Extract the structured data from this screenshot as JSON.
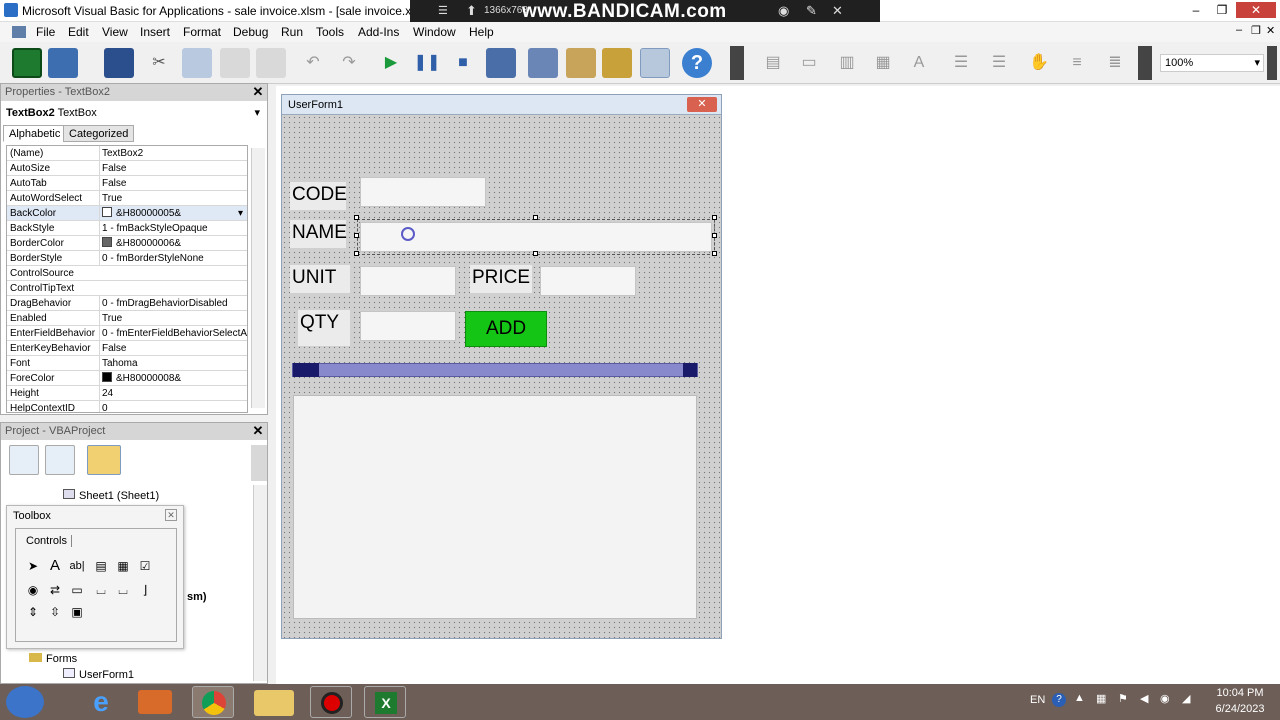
{
  "window": {
    "title": "Microsoft Visual Basic for Applications - sale invoice.xlsm - [sale invoice.xlsm - U",
    "minimize": "–",
    "restore": "❐",
    "close": "✕"
  },
  "recorder": {
    "resolution": "1366x768",
    "watermark": "www.BANDICAM.com"
  },
  "menu": [
    "File",
    "Edit",
    "View",
    "Insert",
    "Format",
    "Debug",
    "Run",
    "Tools",
    "Add-Ins",
    "Window",
    "Help"
  ],
  "mdi_controls": {
    "minimize": "–",
    "restore": "❐",
    "close": "✕"
  },
  "toolbar": {
    "zoom": "100%"
  },
  "properties": {
    "title": "Properties - TextBox2",
    "object_name": "TextBox2",
    "object_type": "TextBox",
    "tabs": [
      "Alphabetic",
      "Categorized"
    ],
    "rows": [
      {
        "name": "(Name)",
        "value": "TextBox2"
      },
      {
        "name": "AutoSize",
        "value": "False"
      },
      {
        "name": "AutoTab",
        "value": "False"
      },
      {
        "name": "AutoWordSelect",
        "value": "True"
      },
      {
        "name": "BackColor",
        "value": "&H80000005&",
        "swatch": "#ffffff"
      },
      {
        "name": "BackStyle",
        "value": "1 - fmBackStyleOpaque"
      },
      {
        "name": "BorderColor",
        "value": "&H80000006&",
        "swatch": "#666666"
      },
      {
        "name": "BorderStyle",
        "value": "0 - fmBorderStyleNone"
      },
      {
        "name": "ControlSource",
        "value": ""
      },
      {
        "name": "ControlTipText",
        "value": ""
      },
      {
        "name": "DragBehavior",
        "value": "0 - fmDragBehaviorDisabled"
      },
      {
        "name": "Enabled",
        "value": "True"
      },
      {
        "name": "EnterFieldBehavior",
        "value": "0 - fmEnterFieldBehaviorSelectAl"
      },
      {
        "name": "EnterKeyBehavior",
        "value": "False"
      },
      {
        "name": "Font",
        "value": "Tahoma"
      },
      {
        "name": "ForeColor",
        "value": "&H80000008&",
        "swatch": "#000000"
      },
      {
        "name": "Height",
        "value": "24"
      },
      {
        "name": "HelpContextID",
        "value": "0"
      }
    ]
  },
  "project": {
    "title": "Project - VBAProject",
    "tree": {
      "sheet1": "Sheet1 (Sheet1)",
      "partial_label": "sm)",
      "forms": "Forms",
      "userform1": "UserForm1"
    }
  },
  "toolbox": {
    "title": "Toolbox",
    "tab": "Controls"
  },
  "userform": {
    "title": "UserForm1",
    "close": "✕",
    "labels": {
      "code": "CODE",
      "name": "NAME",
      "unit": "UNIT",
      "price": "PRICE",
      "qty": "QTY"
    },
    "add_button": "ADD"
  },
  "tray": {
    "language": "EN",
    "time": "10:04 PM",
    "date": "6/24/2023"
  },
  "colors": {
    "add_button": "#15c515",
    "scrollbar": "#8888cc",
    "taskbar": "#6d5e57"
  }
}
